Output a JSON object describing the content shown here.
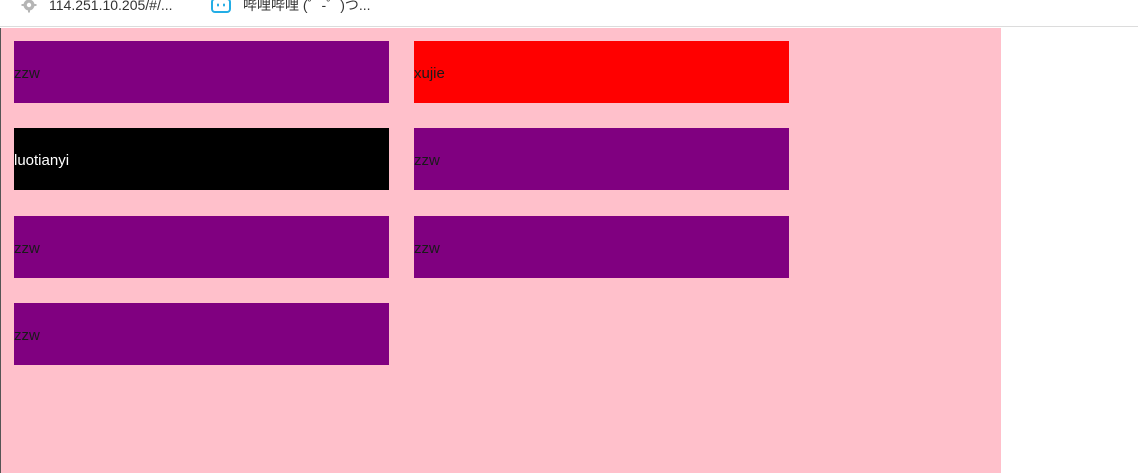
{
  "bookmarks": [
    {
      "label": "114.251.10.205/#/...",
      "icon": "gear-icon"
    },
    {
      "label": "哔哩哔哩 (゜-゜)つ...",
      "icon": "bilibili-tv-icon"
    }
  ],
  "colors": {
    "container_bg": "#ffc0cb",
    "purple": "#800080",
    "red": "#ff0000",
    "black": "#000000",
    "text_dark": "#1a1a1a",
    "text_light": "#ffffff"
  },
  "boxes": [
    {
      "label": "zzw",
      "bg": "#800080",
      "color": "#1a1a1a"
    },
    {
      "label": "xujie",
      "bg": "#ff0000",
      "color": "#1a1a1a"
    },
    {
      "label": "luotianyi",
      "bg": "#000000",
      "color": "#ffffff"
    },
    {
      "label": "zzw",
      "bg": "#800080",
      "color": "#1a1a1a"
    },
    {
      "label": "zzw",
      "bg": "#800080",
      "color": "#1a1a1a"
    },
    {
      "label": "zzw",
      "bg": "#800080",
      "color": "#1a1a1a"
    },
    {
      "label": "zzw",
      "bg": "#800080",
      "color": "#1a1a1a"
    }
  ]
}
